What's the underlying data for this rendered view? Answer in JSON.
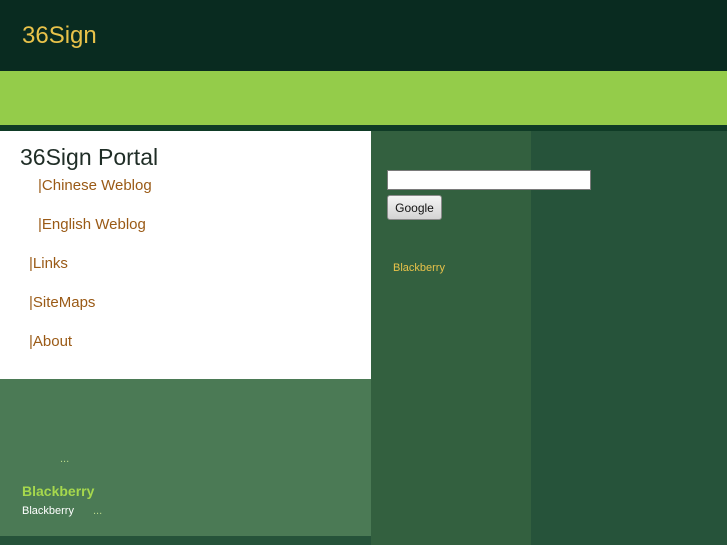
{
  "header": {
    "site_title": "36Sign"
  },
  "portal": {
    "title": "36Sign Portal",
    "nav": [
      {
        "label": "|Chinese Weblog"
      },
      {
        "label": "|English Weblog"
      },
      {
        "label": "|Links"
      },
      {
        "label": "|SiteMaps"
      },
      {
        "label": "|About"
      }
    ]
  },
  "lower": {
    "more_1": "...",
    "heading": "Blackberry",
    "item_text": "Blackberry",
    "more_2": "..."
  },
  "search": {
    "input_value": "",
    "button_label": "Google"
  },
  "sidebar": {
    "link": "Blackberry"
  },
  "colors": {
    "header_bg": "#092b20",
    "accent_bar": "#94cc4a",
    "title_gold": "#e8c24a",
    "link_brown": "#9a5a16"
  }
}
